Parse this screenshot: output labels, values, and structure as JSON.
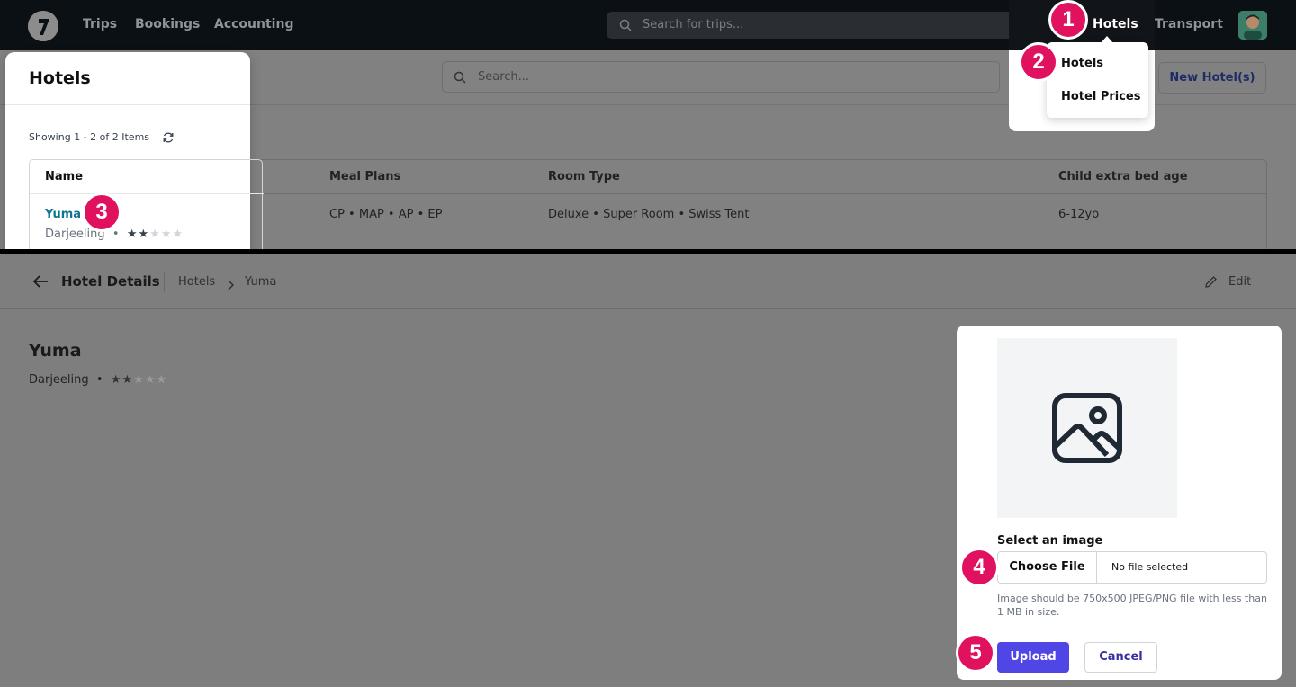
{
  "navbar": {
    "links": [
      "Trips",
      "Bookings",
      "Accounting"
    ],
    "search_placeholder": "Search for trips...",
    "hotels_label": "Hotels",
    "transport_label": "Transport"
  },
  "hotels_menu": {
    "items": [
      "Hotels",
      "Hotel Prices"
    ]
  },
  "hotels_page": {
    "title": "Hotels",
    "search_placeholder": "Search...",
    "new_button": "New Hotel(s)",
    "showing": "Showing 1 - 2 of 2 Items",
    "columns": [
      "Name",
      "Meal Plans",
      "Room Type",
      "Child extra bed age"
    ],
    "rows": [
      {
        "name": "Yuma",
        "city": "Darjeeling",
        "stars": 2,
        "meal_plans": "CP • MAP • AP • EP",
        "room_type": "Deluxe • Super Room • Swiss Tent",
        "child_age": "6-12yo"
      }
    ]
  },
  "details_page": {
    "back_title": "Hotel Details",
    "breadcrumb": [
      "Hotels",
      "Yuma"
    ],
    "edit_label": "Edit",
    "hotel_name": "Yuma",
    "city": "Darjeeling",
    "stars": 2,
    "max_stars": 5
  },
  "upload_card": {
    "select_label": "Select an image",
    "choose_label": "Choose File",
    "no_file": "No file selected",
    "hint": "Image should be 750x500 JPEG/PNG file with less than 1 MB in size.",
    "upload_label": "Upload",
    "cancel_label": "Cancel"
  },
  "steps": [
    "1",
    "2",
    "3",
    "4",
    "5"
  ],
  "colors": {
    "accent": "#4f46e5",
    "step_badge": "#e0115f",
    "link": "#0e7490",
    "navbar": "#0b1014"
  }
}
